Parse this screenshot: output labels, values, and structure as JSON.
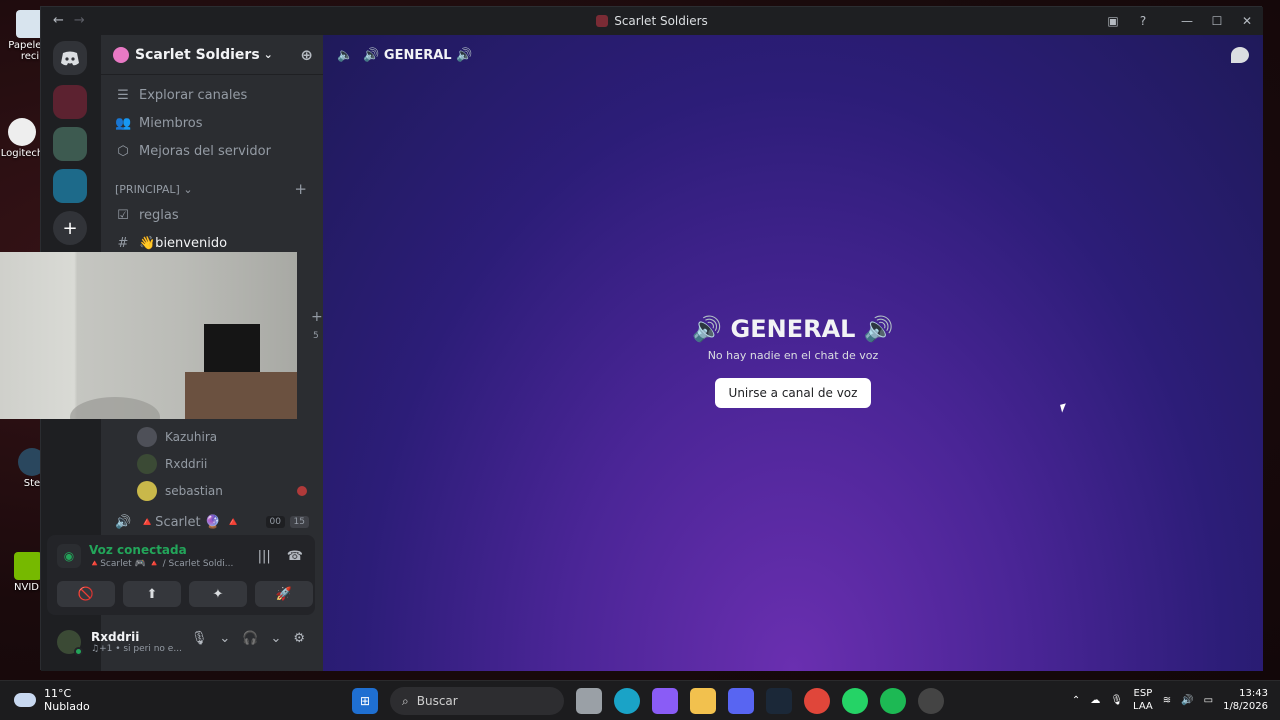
{
  "window": {
    "title": "Scarlet Soldiers",
    "back": "←",
    "forward": "→"
  },
  "titlebar_buttons": {
    "inbox": "▣",
    "help": "?",
    "minimize": "—",
    "maximize": "☐",
    "close": "✕"
  },
  "desktop_icons": [
    {
      "label": "Papelera\nreci"
    },
    {
      "label": "Logitech"
    },
    {
      "label": "Ste"
    },
    {
      "label": "NVIDI"
    }
  ],
  "server": {
    "name": "Scarlet Soldiers",
    "chevron": "⌄",
    "invite_icon": "person-add-icon"
  },
  "nav": [
    {
      "label": "Explorar canales",
      "icon": "☰"
    },
    {
      "label": "Miembros",
      "icon": "👥"
    },
    {
      "label": "Mejoras del servidor",
      "icon": "⬡"
    }
  ],
  "category": {
    "label": "[PRINCIPAL] ⌄",
    "plus": "+"
  },
  "channels": [
    {
      "icon": "☑",
      "label": "reglas"
    },
    {
      "icon": "#",
      "label": "👋bienvenido"
    }
  ],
  "hidden_plus": "+",
  "hidden_badge": "5",
  "members": [
    {
      "name": "Kazuhira"
    },
    {
      "name": "Rxddrii"
    },
    {
      "name": "sebastian"
    }
  ],
  "voice_channel_row": {
    "label": "🔺Scarlet 🔮 🔺",
    "count_a": "00",
    "count_b": "15"
  },
  "voice_panel": {
    "status": "Voz conectada",
    "sub": "🔺Scarlet 🎮 🔺 / Scarlet Soldi...",
    "actions": [
      "🚫",
      "⬆",
      "✦",
      "🚀"
    ]
  },
  "user": {
    "name": "Rxddrii",
    "status": "♫+1 • si peri no e..."
  },
  "main": {
    "channel": "🔊 GENERAL 🔊",
    "title": "🔊 GENERAL 🔊",
    "empty_text": "No hay nadie en el chat de voz",
    "join_label": "Unirse a canal de voz"
  },
  "taskbar": {
    "weather_temp": "11°C",
    "weather_desc": "Nublado",
    "search_placeholder": "Buscar",
    "lang_a": "ESP",
    "lang_b": "LAA",
    "time": "13:43",
    "date": "1/8/2026"
  },
  "colors": {
    "accent_green": "#23a55a",
    "sidebar": "#2b2d31",
    "guilds": "#1e1f22"
  }
}
